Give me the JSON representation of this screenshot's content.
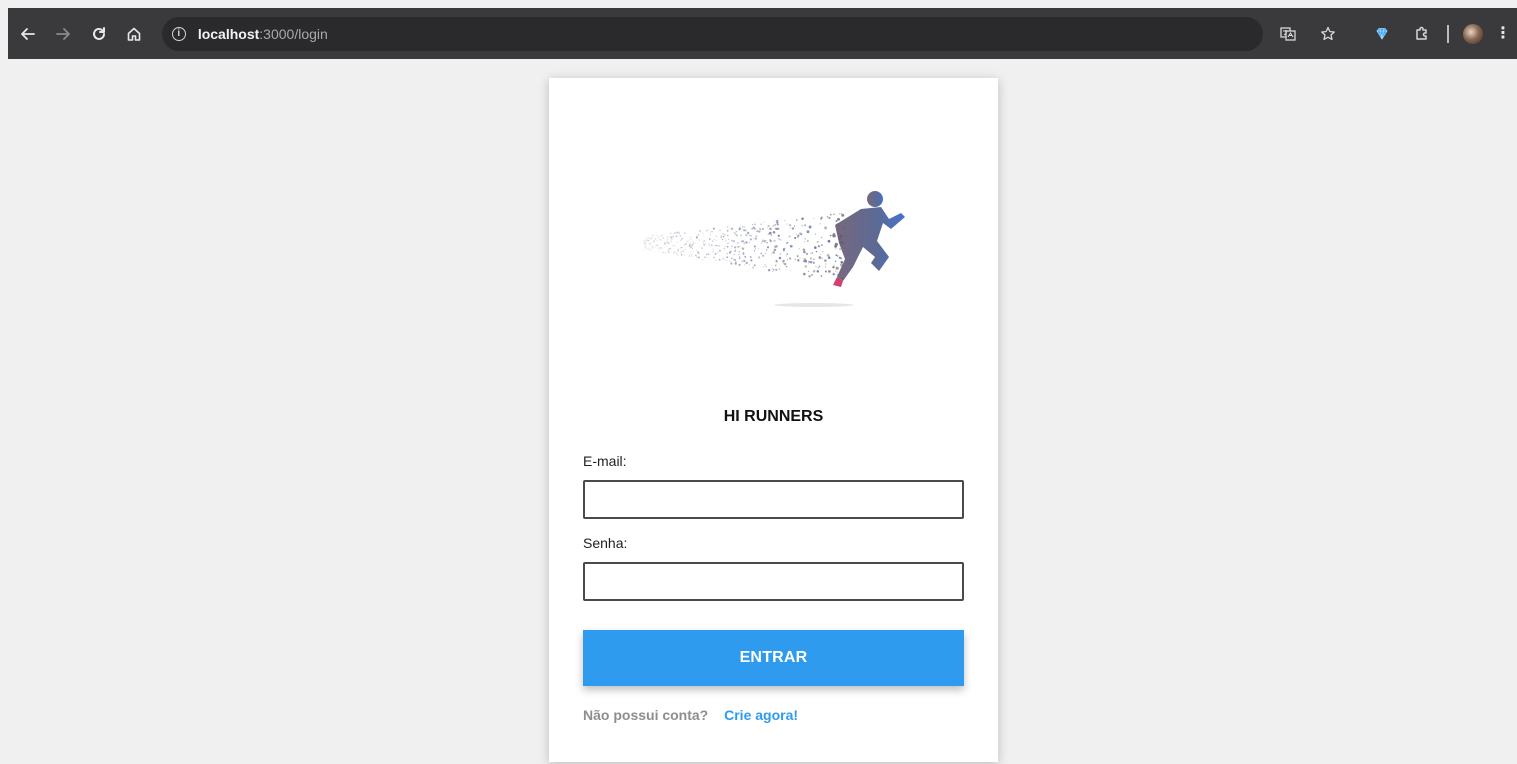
{
  "browser": {
    "url_host": "localhost",
    "url_path": ":3000/login",
    "icons": [
      "back-arrow-icon",
      "forward-arrow-icon",
      "reload-icon",
      "home-icon",
      "site-info-icon",
      "translate-icon",
      "bookmark-star-icon",
      "extension-gem-icon",
      "extensions-puzzle-icon",
      "profile-avatar",
      "more-menu-icon"
    ],
    "more_glyph": "⋮"
  },
  "login": {
    "title": "HI RUNNERS",
    "email_label": "E-mail:",
    "email_value": "",
    "password_label": "Senha:",
    "password_value": "",
    "submit_label": "ENTRAR",
    "signup_prompt": "Não possui conta?",
    "signup_link": "Crie agora!"
  },
  "colors": {
    "accent": "#2e9bef",
    "page_background": "#f0f0f0",
    "toolbar": "#3a3a3c",
    "muted_text": "#8e8e8e"
  }
}
